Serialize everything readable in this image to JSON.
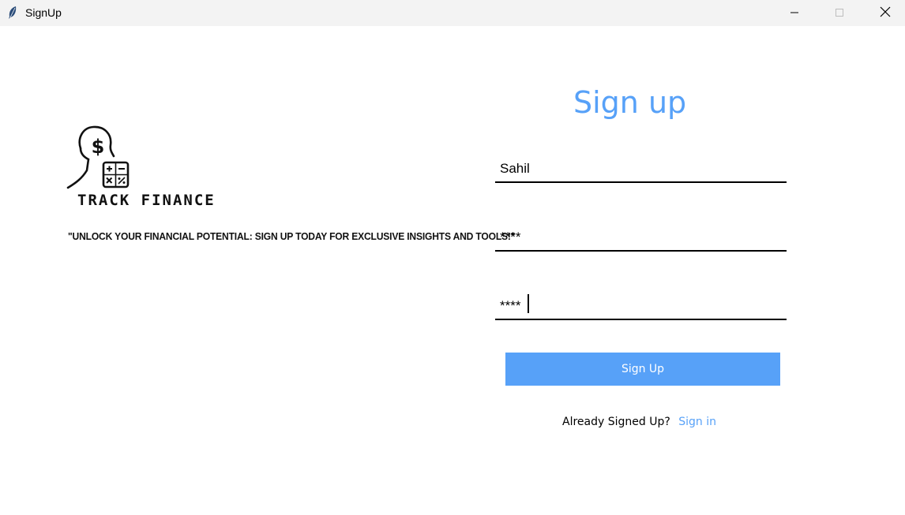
{
  "window": {
    "title": "SignUp",
    "icon": "feather-icon",
    "controls": [
      "minimize-icon",
      "maximize-icon",
      "close-icon"
    ]
  },
  "brand": {
    "name": "TRACK FINANCE",
    "tagline": "\"UNLOCK YOUR FINANCIAL POTENTIAL: SIGN UP TODAY FOR EXCLUSIVE INSIGHTS AND TOOLS!\"",
    "logo_icon": "head-dollar-calculator-icon"
  },
  "form": {
    "title": "Sign up",
    "username_value": "Sahil",
    "password_value": "****",
    "confirm_password_value": "****",
    "submit_label": "Sign Up",
    "signin_prompt": "Already Signed Up?",
    "signin_link": "Sign in"
  },
  "colors": {
    "accent": "#57a1f8",
    "titlebar": "#f3f3f3",
    "background": "#ffffff"
  }
}
